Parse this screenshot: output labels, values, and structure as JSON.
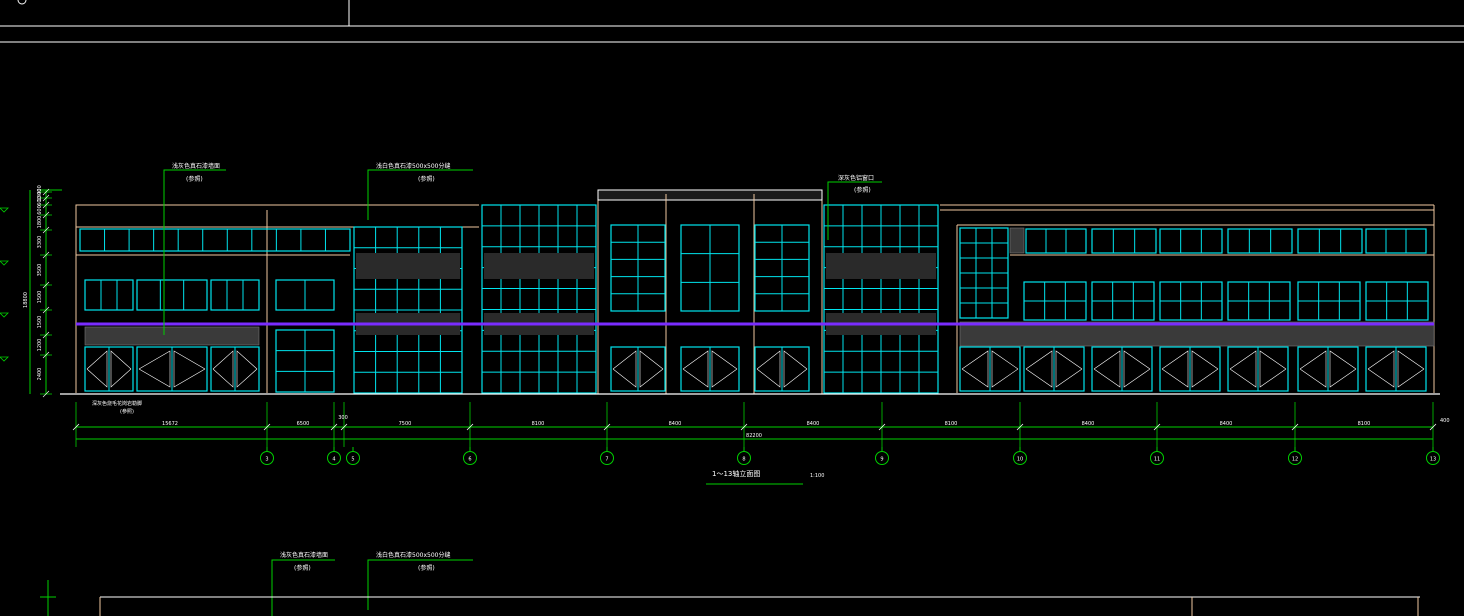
{
  "drawing": {
    "title": "1～13轴立面图",
    "scale": "1:100",
    "total_dimension": "82200",
    "segment_dimensions": [
      "15672",
      "6500",
      "300",
      "7500",
      "8100",
      "8400",
      "8400",
      "8100",
      "8400",
      "8400",
      "8100"
    ],
    "end_dimension": "400",
    "axis_labels": [
      "3",
      "4",
      "5",
      "6",
      "7",
      "8",
      "9",
      "10",
      "11",
      "12",
      "13"
    ],
    "height_dimensions": [
      "2400",
      "1200",
      "1500",
      "1500",
      "3500",
      "3300",
      "1800",
      "600",
      "600",
      "1300",
      "900"
    ],
    "overall_height": "18800",
    "annotations": {
      "stone_base": "浅灰色真石漆墙面",
      "stone_base_ref": "(参照)",
      "stone_panel": "浅白色真石漆500x500分缝",
      "stone_panel_ref": "(参照)",
      "window_line": "深灰色铝窗口",
      "window_line_ref": "(参照)",
      "ground_note": "深灰色烧毛花岗岩勒脚",
      "ground_note_ref": "(参照)"
    },
    "second_view": {
      "stone_base": "浅灰色真石漆墙面",
      "stone_base_ref": "(参照)",
      "stone_panel": "浅白色真石漆500x500分缝",
      "stone_panel_ref": "(参照)"
    }
  },
  "colors": {
    "background": "#000000",
    "outline": "#f0c8a0",
    "glazing": "#00e5ee",
    "dimension": "#00d000",
    "highlight": "#7a2cff",
    "frame": "#ffffff",
    "fill_dark": "#3a3a3a"
  }
}
